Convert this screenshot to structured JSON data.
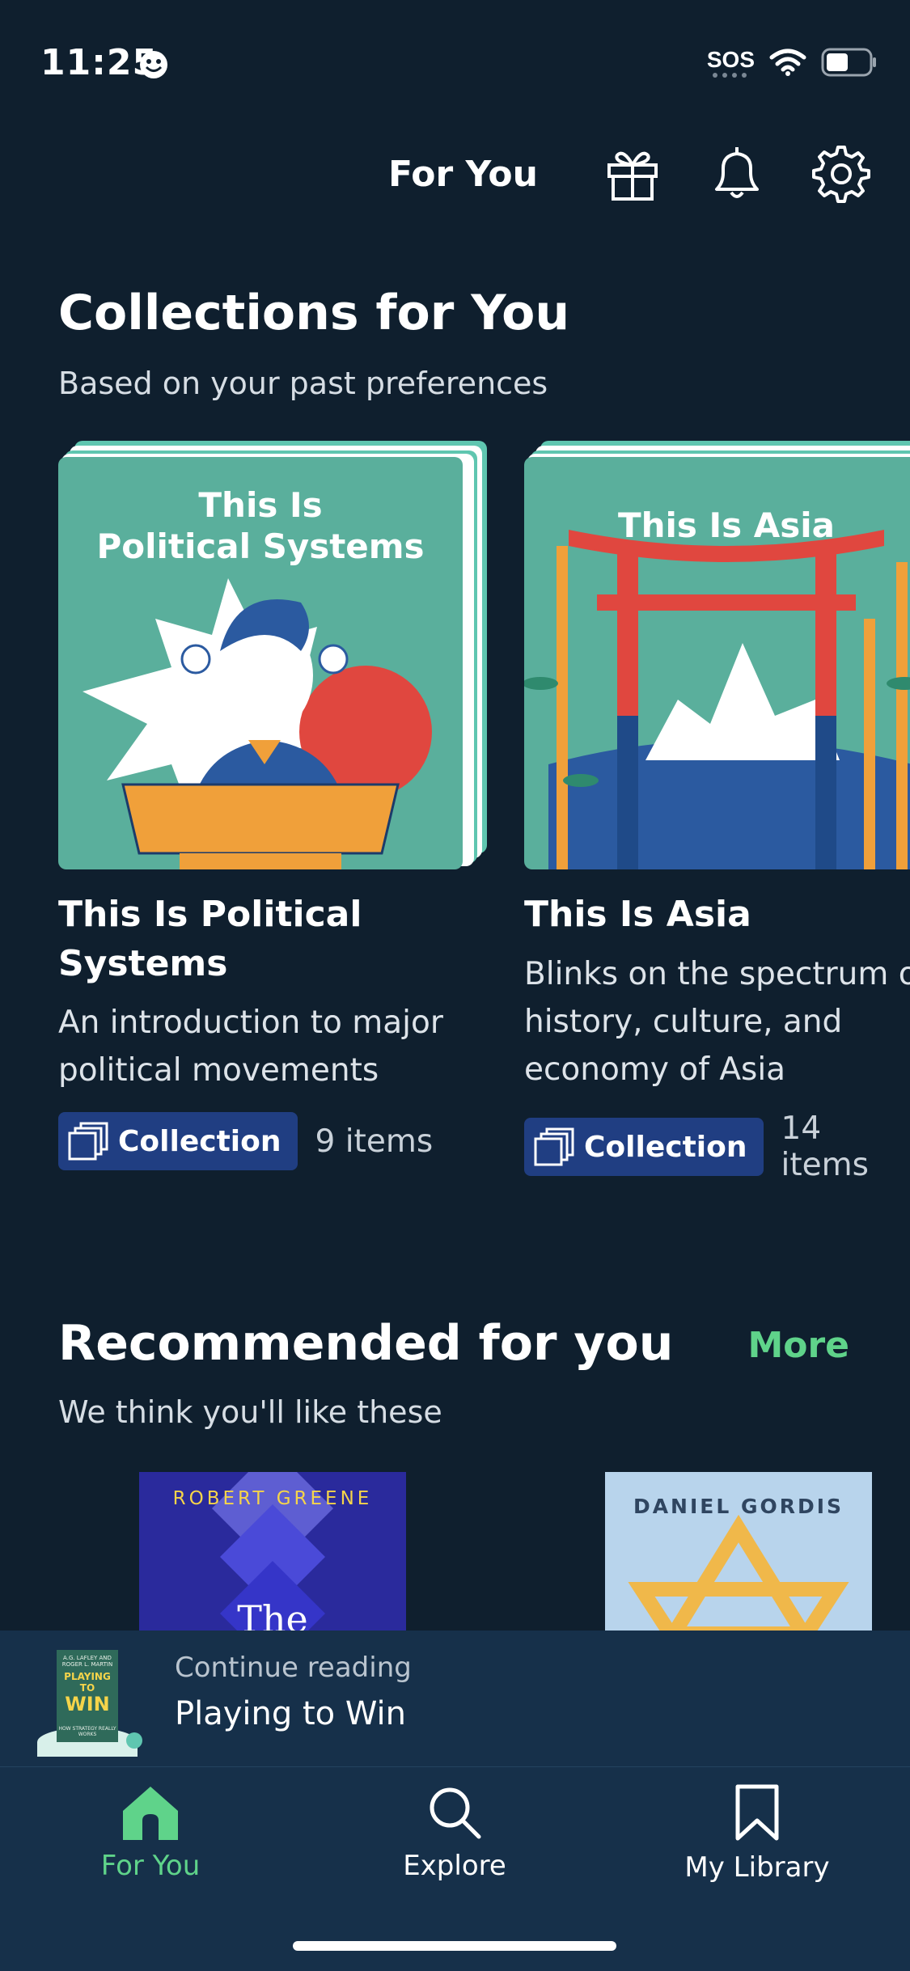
{
  "status_bar": {
    "time": "11:25",
    "carrier": "SOS"
  },
  "header": {
    "title": "For You"
  },
  "collections": {
    "title": "Collections for You",
    "subtitle": "Based on your past preferences",
    "cards": [
      {
        "art_title_line1": "This Is",
        "art_title_line2": "Political Systems",
        "title_line1": "This Is Political",
        "title_line2": "Systems",
        "desc_line1": "An introduction to major",
        "desc_line2": "political movements",
        "badge": "Collection",
        "count": "9 items"
      },
      {
        "art_title": "This Is Asia",
        "title_line1": "This Is Asia",
        "desc_line1": "Blinks on the spectrum o",
        "desc_line2": "history, culture, and",
        "desc_line3": "economy of Asia",
        "badge": "Collection",
        "count": "14 items"
      }
    ]
  },
  "recommended": {
    "title": "Recommended for you",
    "more": "More",
    "subtitle": "We think you'll like these",
    "books": [
      {
        "author": "ROBERT GREENE",
        "title_fragment": "The"
      },
      {
        "author": "DANIEL GORDIS"
      }
    ]
  },
  "continue_reading": {
    "label": "Continue reading",
    "title": "Playing to Win",
    "cover_small_authors": "A.G. LAFLEY AND ROGER L. MARTIN",
    "cover_title_line1": "PLAYING TO",
    "cover_title_line2": "WIN",
    "cover_tagline": "HOW STRATEGY REALLY WORKS"
  },
  "tabs": [
    {
      "label": "For You",
      "active": true
    },
    {
      "label": "Explore",
      "active": false
    },
    {
      "label": "My Library",
      "active": false
    }
  ],
  "colors": {
    "accent": "#5fd38a",
    "background": "#0f1f2e",
    "bar": "#16304a",
    "badge": "#203e82"
  }
}
